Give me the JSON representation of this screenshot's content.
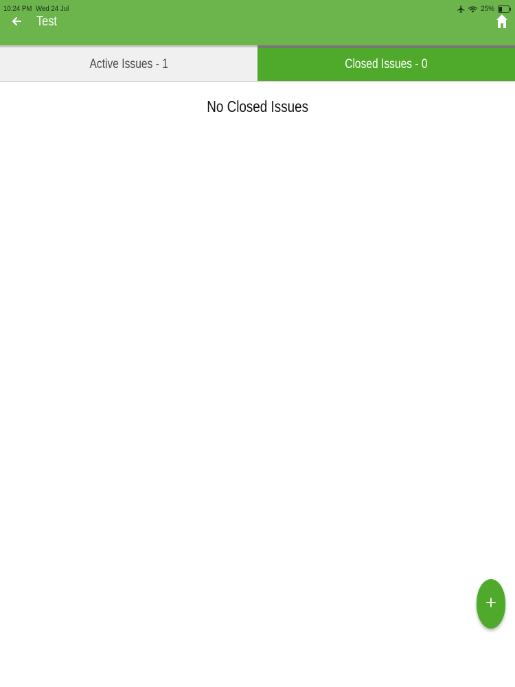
{
  "status_bar": {
    "time": "10:24 PM",
    "date": "Wed 24 Jul",
    "battery": "25%"
  },
  "nav": {
    "title": "Test",
    "back_icon": "arrow-left-icon",
    "home_icon": "home-icon"
  },
  "tabs": [
    {
      "label": "Active Issues - 1",
      "active": false
    },
    {
      "label": "Closed Issues - 0",
      "active": true
    }
  ],
  "main": {
    "empty_message": "No Closed Issues"
  },
  "fab": {
    "icon": "plus-icon"
  },
  "colors": {
    "header": "#6bb54c",
    "accent": "#4faa2b",
    "tab_inactive_bg": "#f0f0f0"
  }
}
